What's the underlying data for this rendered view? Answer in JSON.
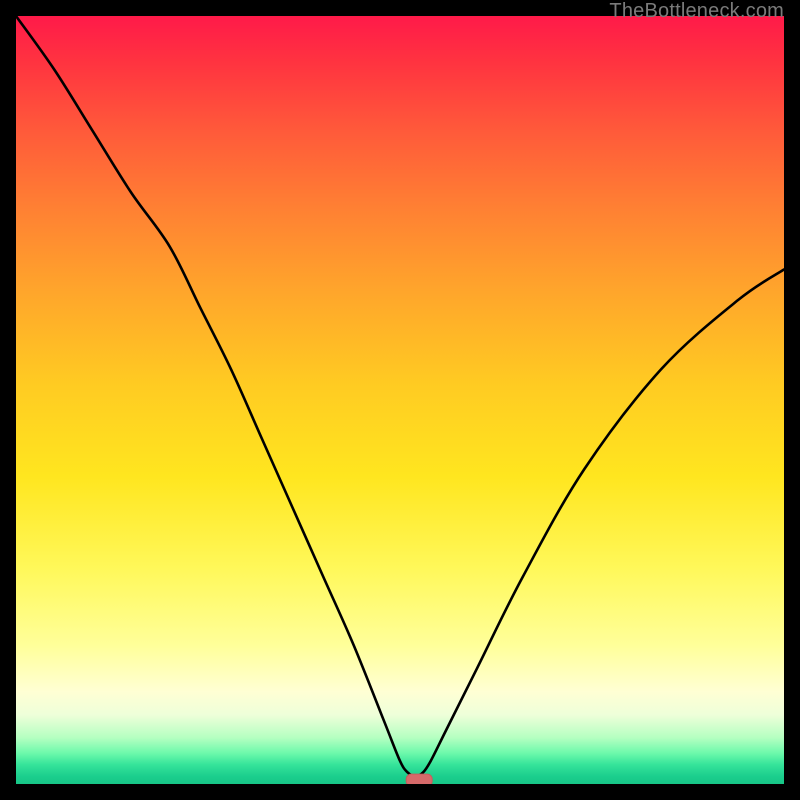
{
  "attribution": "TheBottleneck.com",
  "colors": {
    "frame": "#000000",
    "curve": "#000000",
    "marker": "#d66a6a",
    "gradient_top": "#ff1a49",
    "gradient_bottom": "#17c687"
  },
  "chart_data": {
    "type": "line",
    "title": "",
    "xlabel": "",
    "ylabel": "",
    "xlim": [
      0,
      100
    ],
    "ylim": [
      0,
      100
    ],
    "grid": false,
    "legend": false,
    "annotations": [
      {
        "kind": "marker",
        "shape": "rounded-rect",
        "x": 52.5,
        "y": 0.5,
        "label": "minimum"
      }
    ],
    "series": [
      {
        "name": "bottleneck-curve",
        "x": [
          0,
          5,
          10,
          15,
          20,
          24,
          28,
          32,
          36,
          40,
          44,
          48,
          50,
          51,
          52,
          53,
          54,
          56,
          60,
          66,
          74,
          84,
          94,
          100
        ],
        "y": [
          100,
          93,
          85,
          77,
          70,
          62,
          54,
          45,
          36,
          27,
          18,
          8,
          3,
          1.5,
          1,
          1.5,
          3,
          7,
          15,
          27,
          41,
          54,
          63,
          67
        ]
      }
    ]
  }
}
